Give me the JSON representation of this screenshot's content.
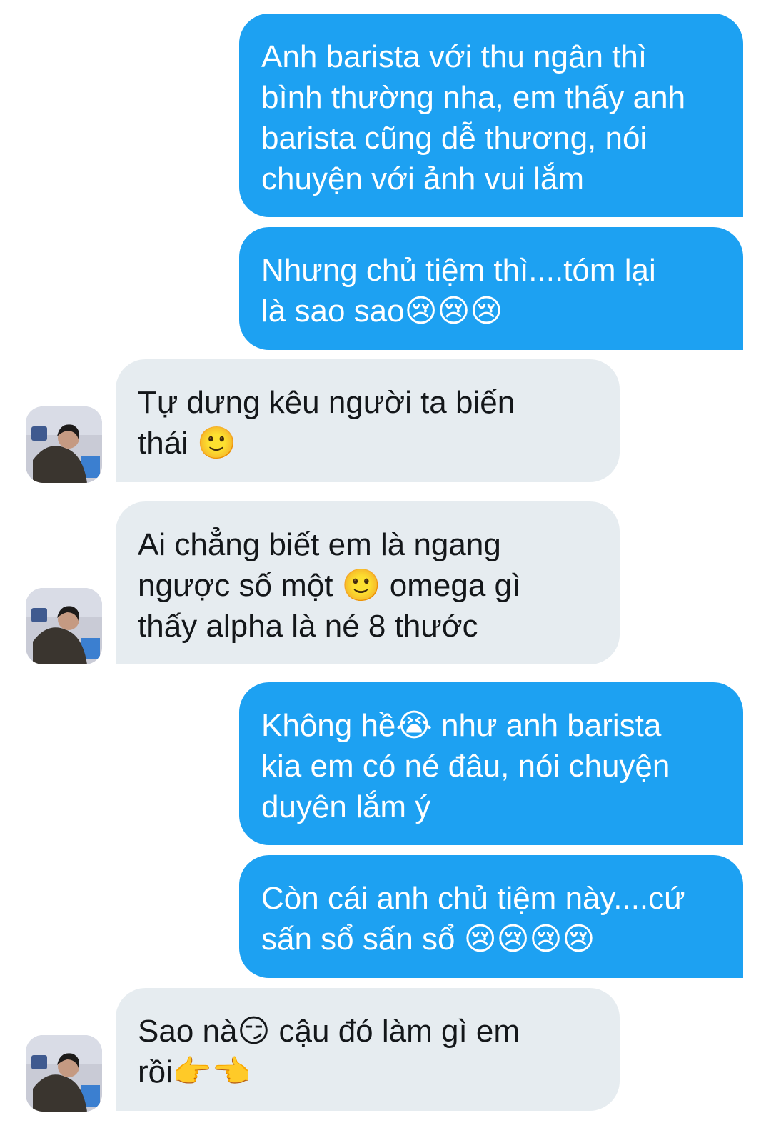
{
  "conversation": {
    "messages": [
      {
        "sender": "me",
        "text": "Anh barista với thu ngân thì\nbình thường nha, em thấy anh\nbarista cũng dễ thương, nói\nchuyện với ảnh vui lắm"
      },
      {
        "sender": "me",
        "text": "Nhưng chủ tiệm thì....tóm lại\nlà sao sao😢😢😢"
      },
      {
        "sender": "other",
        "text": "Tự dưng kêu người ta biến\nthái 🙂"
      },
      {
        "sender": "other",
        "text": "Ai chẳng biết em là ngang\nngược số một 🙂 omega gì\nthấy alpha là né 8 thước"
      },
      {
        "sender": "me",
        "text": "Không hề😭 như anh barista\nkia em có né đâu, nói chuyện\nduyên lắm ý"
      },
      {
        "sender": "me",
        "text": "Còn cái anh chủ tiệm này....cứ\nsấn sổ sấn sổ 😢😢😢😢"
      },
      {
        "sender": "other",
        "text": "Sao nà😏 cậu đó làm gì em\nrồi👉👈"
      }
    ]
  },
  "colors": {
    "sent_bubble": "#1da1f2",
    "received_bubble": "#e6ecf0",
    "received_text": "#14171a",
    "background": "#ffffff"
  },
  "icons": {
    "avatar": "user-avatar-photo"
  }
}
